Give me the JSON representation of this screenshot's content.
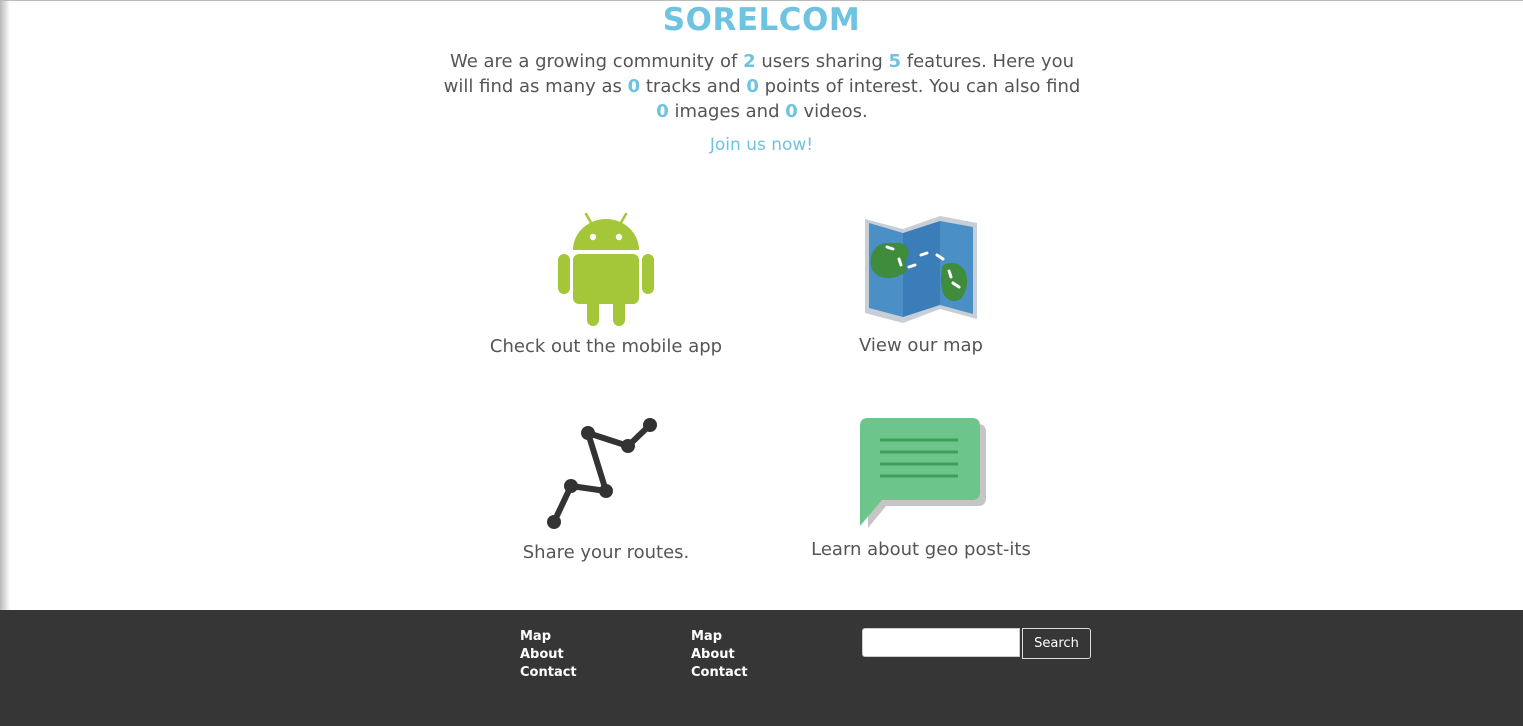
{
  "site": {
    "title": "SORELCOM"
  },
  "intro": {
    "text1": "We are a growing community of ",
    "users": "2",
    "text2": " users sharing ",
    "features": "5",
    "text3": " features. Here you will find as many as ",
    "tracks": "0",
    "text4": " tracks and ",
    "pois": "0",
    "text5": " points of interest. You can also find ",
    "images": "0",
    "text6": " images and ",
    "videos": "0",
    "text7": " videos."
  },
  "join": {
    "label": "Join us now!"
  },
  "cards": {
    "mobile": {
      "label": "Check out the mobile app",
      "icon": "android-icon"
    },
    "map": {
      "label": "View our map",
      "icon": "map-icon"
    },
    "routes": {
      "label": "Share your routes.",
      "icon": "route-icon"
    },
    "postits": {
      "label": "Learn about geo post-its",
      "icon": "speech-bubble-icon"
    }
  },
  "footer": {
    "col1": [
      "Map",
      "About",
      "Contact"
    ],
    "col2": [
      "Map",
      "About",
      "Contact"
    ],
    "search": {
      "button": "Search",
      "value": ""
    }
  },
  "colors": {
    "accent": "#6ec3e0",
    "android": "#a4c639",
    "footer_bg": "#363636",
    "bubble": "#6cc58a"
  }
}
